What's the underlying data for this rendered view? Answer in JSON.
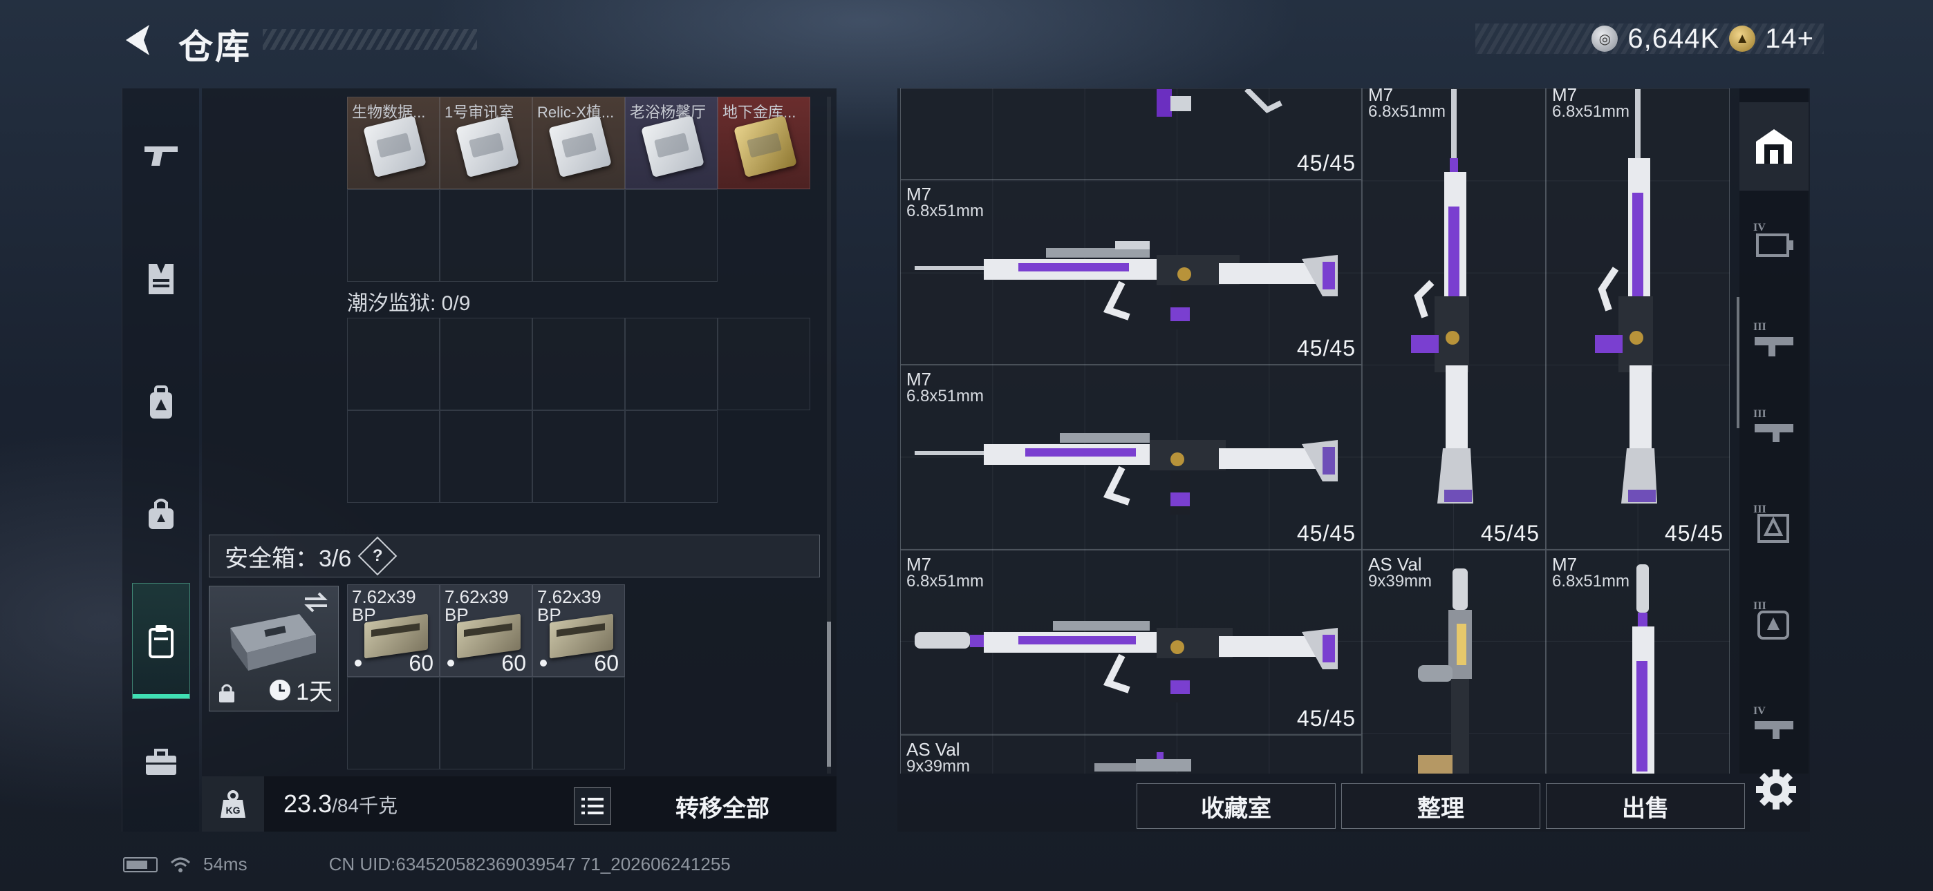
{
  "header": {
    "title": "仓库",
    "currency": [
      {
        "icon": "silver-coin-icon",
        "value": "6,644K"
      },
      {
        "icon": "gold-triangle-coin-icon",
        "value": "14+"
      }
    ]
  },
  "left_nav": [
    {
      "name": "weapons",
      "icon": "pistol-icon"
    },
    {
      "name": "armor",
      "icon": "vest-icon"
    },
    {
      "name": "backpack",
      "icon": "backpack-icon"
    },
    {
      "name": "bag",
      "icon": "bag-icon"
    },
    {
      "name": "secure-container",
      "icon": "clipboard-case-icon",
      "active": true
    },
    {
      "name": "toolbox",
      "icon": "toolbox-icon"
    }
  ],
  "keycards": [
    {
      "label": "生物数据...",
      "style": "c1"
    },
    {
      "label": "1号审讯室",
      "style": "c2"
    },
    {
      "label": "Relic-X植...",
      "style": "c3"
    },
    {
      "label": "老浴杨馨厅",
      "style": "c4"
    },
    {
      "label": "地下金库...",
      "style": "c5",
      "gold": true
    }
  ],
  "prison_section": {
    "label": "潮汐监狱: 0/9"
  },
  "safe_box": {
    "label": "安全箱：3/6",
    "help": "?",
    "duration": "1天",
    "ammo": [
      {
        "caliber": "7.62x39",
        "type": "BP",
        "count": "60"
      },
      {
        "caliber": "7.62x39",
        "type": "BP",
        "count": "60"
      },
      {
        "caliber": "7.62x39",
        "type": "BP",
        "count": "60"
      }
    ]
  },
  "weight": {
    "current": "23.3",
    "max": "/84千克"
  },
  "transfer_all": "转移全部",
  "weapons": [
    {
      "id": "w0",
      "name": "",
      "caliber": "",
      "ammo": "45/45"
    },
    {
      "id": "w1",
      "name": "M7",
      "caliber": "6.8x51mm",
      "ammo": "45/45"
    },
    {
      "id": "w2",
      "name": "M7",
      "caliber": "6.8x51mm",
      "ammo": "45/45"
    },
    {
      "id": "w3",
      "name": "M7",
      "caliber": "6.8x51mm",
      "ammo": "45/45"
    },
    {
      "id": "w4",
      "name": "M7",
      "caliber": "6.8x51mm",
      "ammo": "45/45"
    },
    {
      "id": "w5",
      "name": "M7",
      "caliber": "6.8x51mm",
      "ammo": "45/45"
    },
    {
      "id": "w6",
      "name": "AS Val",
      "caliber": "9x39mm",
      "ammo": ""
    },
    {
      "id": "w7",
      "name": "M7",
      "caliber": "6.8x51mm",
      "ammo": ""
    },
    {
      "id": "w8",
      "name": "AS Val",
      "caliber": "9x39mm",
      "ammo": ""
    }
  ],
  "right_nav": [
    {
      "icon": "home-icon",
      "active": true
    },
    {
      "icon": "tier-iv-icon",
      "label": "IV"
    },
    {
      "icon": "tier-iii-icon",
      "label": "III"
    },
    {
      "icon": "tier-iii-icon",
      "label": "III"
    },
    {
      "icon": "tier-iii-icon",
      "label": "III"
    },
    {
      "icon": "tier-iii-icon",
      "label": "III"
    },
    {
      "icon": "tier-iv-icon",
      "label": "IV"
    }
  ],
  "actions": {
    "collection": "收藏室",
    "sort": "整理",
    "sell": "出售"
  },
  "status_bar": {
    "ping": "54ms",
    "uid": "CN UID:634520582369039547 71_202606241255"
  },
  "colors": {
    "accent_green": "#3fe0b3",
    "purple": "#7a3fd0"
  }
}
